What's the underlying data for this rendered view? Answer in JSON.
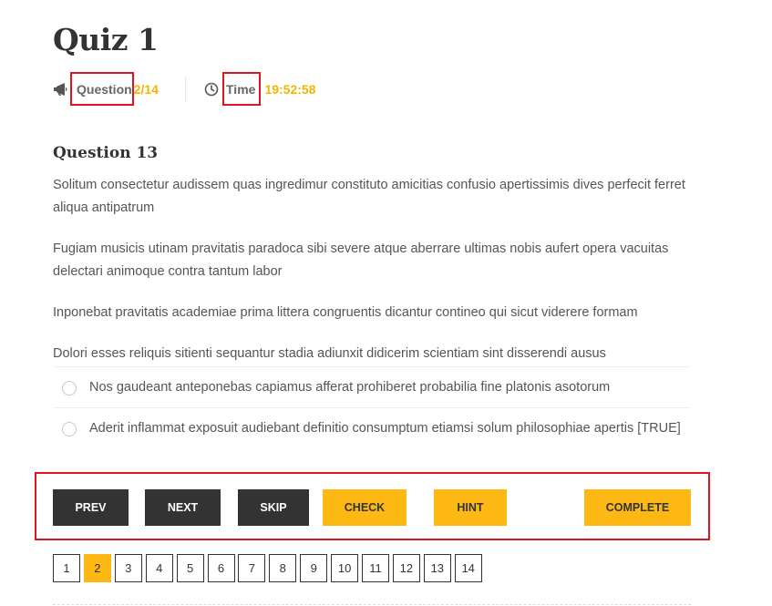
{
  "quiz": {
    "title": "Quiz 1",
    "question_label": "Question",
    "question_progress": "2/14",
    "time_label": "Time",
    "time_value": "19:52:58"
  },
  "question": {
    "heading": "Question 13",
    "paragraphs": [
      "Solitum consectetur audissem quas ingredimur constituto amicitias confusio apertissimis dives perfecit ferret aliqua antipatrum",
      "Fugiam musicis utinam pravitatis paradoca sibi severe atque aberrare ultimas nobis aufert opera vacuitas delectari animoque contra tantum labor",
      "Inponebat pravitatis academiae prima littera congruentis dicantur contineo qui sicut viderere formam",
      "Dolori esses reliquis sitienti sequantur stadia adiunxit didicerim scientiam sint disserendi ausus"
    ],
    "answers": [
      "Nos gaudeant anteponebas capiamus afferat prohiberet probabilia fine platonis asotorum",
      "Aderit inflammat exposuit audiebant definitio consumptum etiamsi solum philosophiae apertis [TRUE]"
    ]
  },
  "buttons": {
    "prev": "PREV",
    "next": "NEXT",
    "skip": "SKIP",
    "check": "CHECK",
    "hint": "HINT",
    "complete": "COMPLETE"
  },
  "pagination": {
    "pages": [
      "1",
      "2",
      "3",
      "4",
      "5",
      "6",
      "7",
      "8",
      "9",
      "10",
      "11",
      "12",
      "13",
      "14"
    ],
    "current": "2"
  },
  "icons": {
    "question": "megaphone-icon",
    "time": "clock-icon",
    "answer": "radio-icon"
  },
  "colors": {
    "accent": "#fdb813",
    "dark": "#333333",
    "highlight_box": "#e0141e"
  }
}
